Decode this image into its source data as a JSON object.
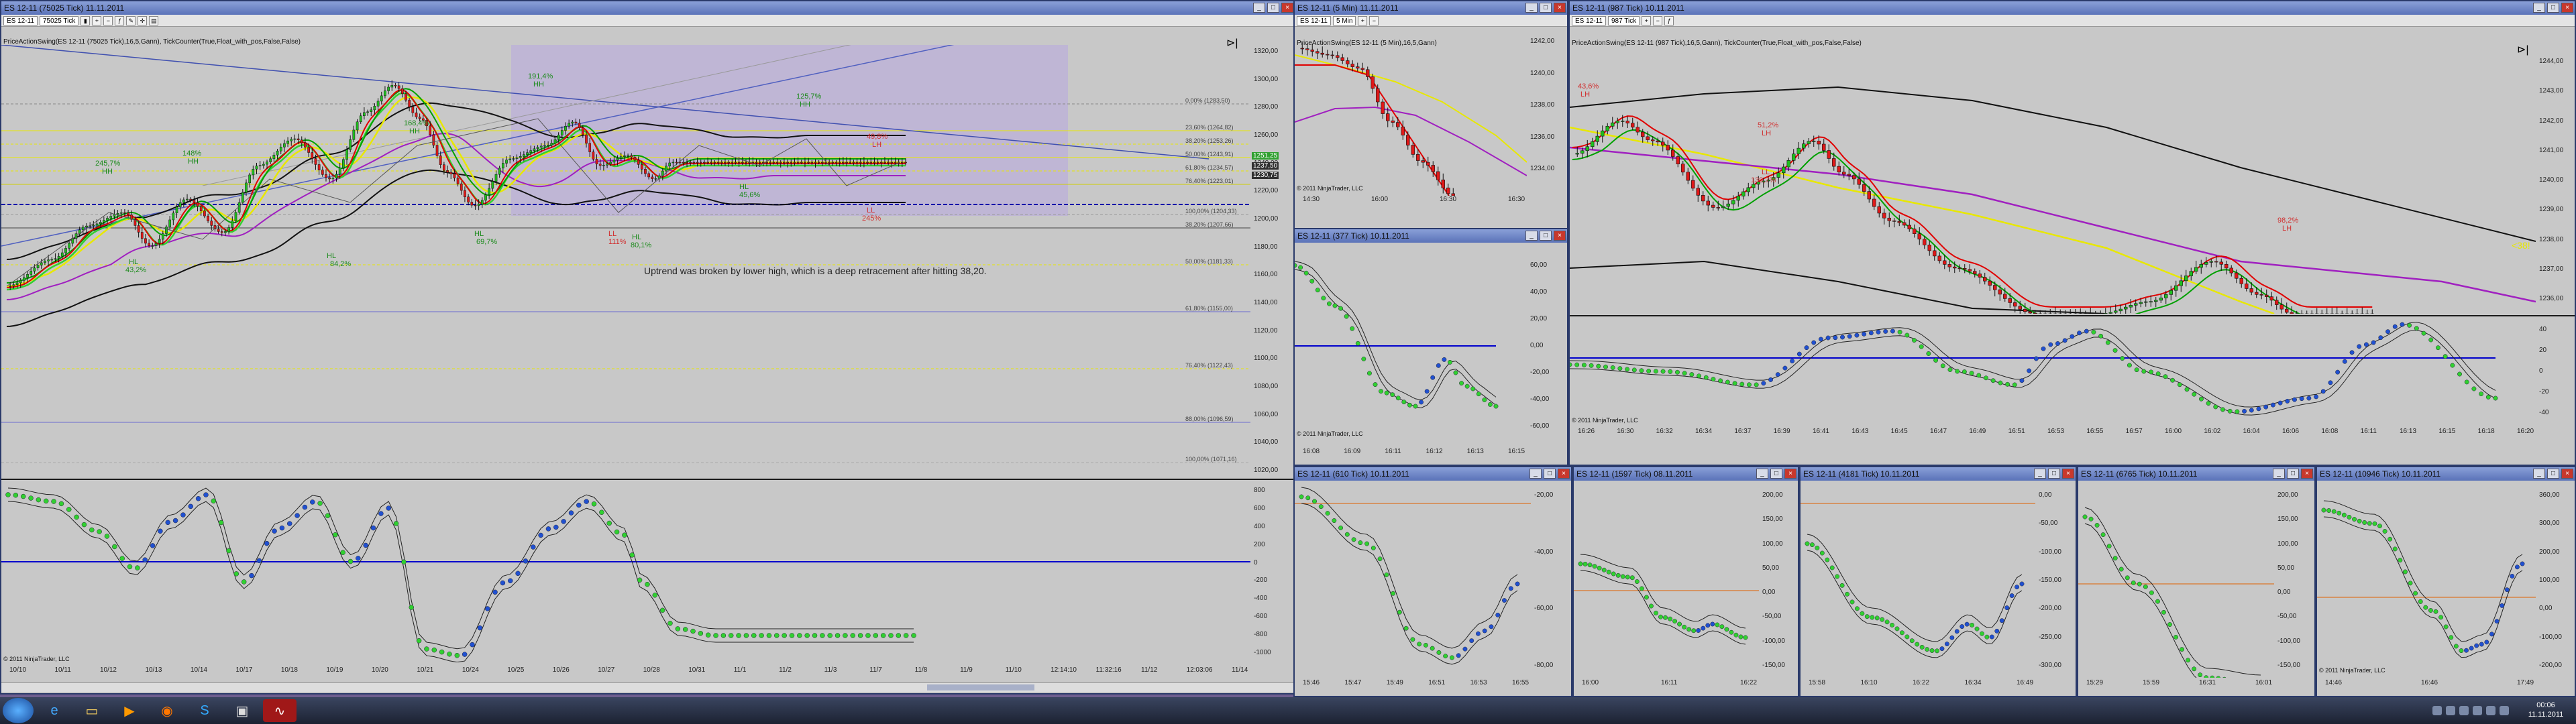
{
  "win_main": {
    "title": "ES 12-11 (75025 Tick)  11.11.2011",
    "instrument": "ES 12-11",
    "period": "75025 Tick",
    "indicator": "PriceActionSwing(ES 12-11 (75025 Tick),16,5,Gann), TickCounter(True,Float_with_pos,False,False)",
    "copyright": "© 2011 NinjaTrader, LLC",
    "annotation": "Uptrend was broken by lower high, which is a deep retracement after hitting 38,20.",
    "price_ticks": [
      "1320,00",
      "1300,00",
      "1280,00",
      "1260,00",
      "1240,00",
      "1220,00",
      "1200,00",
      "1180,00",
      "1160,00",
      "1140,00",
      "1120,00",
      "1100,00",
      "1080,00",
      "1060,00",
      "1040,00",
      "1020,00"
    ],
    "price_tags": [
      "1251,25",
      "1237,50",
      "1230,75"
    ],
    "fib_levels": [
      "0,00% (1283,50)",
      "23,60% (1264,82)",
      "38,20% (1253,26)",
      "50,00% (1243,91)",
      "61,80% (1234,57)",
      "76,40% (1223,01)",
      "100,00% (1204,33)",
      "38,20% (1207,66)",
      "50,00% (1181,33)",
      "61,80% (1155,00)",
      "76,40% (1122,43)",
      "88,00% (1096,59)",
      "100,00% (1071,16)"
    ],
    "osc_ticks": [
      "800",
      "600",
      "400",
      "200",
      "0",
      "-200",
      "-400",
      "-600",
      "-800",
      "-1000"
    ],
    "x_ticks": [
      "10/10",
      "10/11",
      "10/12",
      "10/13",
      "10/14",
      "10/17",
      "10/18",
      "10/19",
      "10/20",
      "10/21",
      "10/24",
      "10/25",
      "10/26",
      "10/27",
      "10/28",
      "10/31",
      "11/1",
      "11/2",
      "11/3",
      "11/7",
      "11/8",
      "11/9",
      "11/10",
      "12:14:10",
      "11:32:16",
      "11/12",
      "12:03:06",
      "11/14"
    ],
    "swing_labels": [
      {
        "t": "245,7%",
        "c": "#1a8a1a"
      },
      {
        "t": "HH",
        "c": "#1a8a1a"
      },
      {
        "t": "148%",
        "c": "#1a8a1a"
      },
      {
        "t": "HH",
        "c": "#1a8a1a"
      },
      {
        "t": "168,4%",
        "c": "#1a8a1a"
      },
      {
        "t": "HH",
        "c": "#1a8a1a"
      },
      {
        "t": "191,4%",
        "c": "#1a8a1a"
      },
      {
        "t": "HH",
        "c": "#1a8a1a"
      },
      {
        "t": "HL",
        "c": "#1a8a1a"
      },
      {
        "t": "43,2%",
        "c": "#1a8a1a"
      },
      {
        "t": "HL",
        "c": "#1a8a1a"
      },
      {
        "t": "84,2%",
        "c": "#1a8a1a"
      },
      {
        "t": "HL",
        "c": "#1a8a1a"
      },
      {
        "t": "69,7%",
        "c": "#1a8a1a"
      },
      {
        "t": "LL",
        "c": "#d03030"
      },
      {
        "t": "111%",
        "c": "#d03030"
      },
      {
        "t": "HL",
        "c": "#1a8a1a"
      },
      {
        "t": "80,1%",
        "c": "#1a8a1a"
      },
      {
        "t": "HL",
        "c": "#1a8a1a"
      },
      {
        "t": "45,6%",
        "c": "#1a8a1a"
      },
      {
        "t": "49,8%",
        "c": "#d03030"
      },
      {
        "t": "LH",
        "c": "#d03030"
      },
      {
        "t": "LL",
        "c": "#d03030"
      },
      {
        "t": "245%",
        "c": "#d03030"
      },
      {
        "t": "125,7%",
        "c": "#1a8a1a"
      },
      {
        "t": "HH",
        "c": "#1a8a1a"
      }
    ]
  },
  "win_w1": {
    "title": "ES 12-11 (5 Min)  11.11.2011",
    "instrument": "ES 12-11",
    "period": "5 Min",
    "indicator": "PriceActionSwing(ES 12-11 (5 Min),16,5,Gann)",
    "price_ticks": [
      "1242,00",
      "1240,00",
      "1238,00",
      "1236,00",
      "1234,00"
    ],
    "x_ticks": [
      "14:30",
      "16:00",
      "16:30",
      "16:30"
    ],
    "copyright": "© 2011 NinjaTrader, LLC"
  },
  "win_w2": {
    "title": "ES 12-11 (377 Tick)  10.11.2011",
    "osc_ticks": [
      "60,00",
      "40,00",
      "20,00",
      "0,00",
      "-20,00",
      "-40,00",
      "-60,00"
    ],
    "x_ticks": [
      "16:08",
      "16:09",
      "16:11",
      "16:12",
      "16:13",
      "16:15"
    ],
    "copyright": "© 2011 NinjaTrader, LLC"
  },
  "win_big": {
    "title": "ES 12-11 (987 Tick)  10.11.2011",
    "instrument": "ES 12-11",
    "period": "987 Tick",
    "indicator": "PriceActionSwing(ES 12-11 (987 Tick),16,5,Gann), TickCounter(True,Float_with_pos,False,False)",
    "price_ticks": [
      "1244,00",
      "1243,00",
      "1242,00",
      "1241,00",
      "1240,00",
      "1239,00",
      "1238,00",
      "1237,00",
      "1236,00"
    ],
    "price_tag": "<38!",
    "swing_labels": [
      {
        "t": "43,6%",
        "c": "#d03030"
      },
      {
        "t": "LH",
        "c": "#d03030"
      },
      {
        "t": "51,2%",
        "c": "#d03030"
      },
      {
        "t": "LH",
        "c": "#d03030"
      },
      {
        "t": "LL",
        "c": "#d03030"
      },
      {
        "t": "139,7%",
        "c": "#d03030"
      },
      {
        "t": "98,2%",
        "c": "#d03030"
      },
      {
        "t": "LH",
        "c": "#d03030"
      }
    ],
    "osc_ticks": [
      "40",
      "20",
      "0",
      "-20",
      "-40"
    ],
    "x_ticks": [
      "16:26",
      "16:30",
      "16:32",
      "16:34",
      "16:37",
      "16:39",
      "16:41",
      "16:43",
      "16:45",
      "16:47",
      "16:49",
      "16:51",
      "16:53",
      "16:55",
      "16:57",
      "16:00",
      "16:02",
      "16:04",
      "16:06",
      "16:08",
      "16:11",
      "16:13",
      "16:15",
      "16:18",
      "16:20"
    ],
    "copyright": "© 2011 NinjaTrader, LLC"
  },
  "win_s1": {
    "title": "ES 12-11 (610 Tick)  10.11.2011",
    "osc_ticks": [
      "-20,00",
      "-40,00",
      "-60,00",
      "-80,00"
    ],
    "y_top": "0,00",
    "x_ticks": [
      "15:46",
      "15:47",
      "15:49",
      "16:51",
      "16:53",
      "16:55"
    ],
    "copyright": "© 2011 NinjaTrader, LLC"
  },
  "win_s2": {
    "title": "ES 12-11 (1597 Tick)  08.11.2011",
    "osc_ticks": [
      "200,00",
      "150,00",
      "100,00",
      "50,00",
      "0,00",
      "-50,00",
      "-100,00",
      "-150,00"
    ],
    "x_ticks": [
      "16:00",
      "16:11",
      "16:22"
    ],
    "copyright": "© 2011 NinjaTrader, LLC"
  },
  "win_s3": {
    "title": "ES 12-11 (4181 Tick)  10.11.2011",
    "osc_ticks": [
      "0,00",
      "-50,00",
      "-100,00",
      "-150,00",
      "-200,00",
      "-250,00",
      "-300,00"
    ],
    "x_ticks": [
      "15:58",
      "16:10",
      "16:22",
      "16:34",
      "16:49"
    ],
    "copyright": "© 2011 NinjaTrader, LLC"
  },
  "win_s4": {
    "title": "ES 12-11 (6765 Tick)  10.11.2011",
    "osc_ticks": [
      "200,00",
      "150,00",
      "100,00",
      "50,00",
      "0,00",
      "-50,00",
      "-100,00",
      "-150,00"
    ],
    "x_ticks": [
      "15:29",
      "15:59",
      "16:31",
      "16:01"
    ],
    "copyright": "© 2011 NinjaTrader, LLC"
  },
  "win_s5": {
    "title": "ES 12-11 (10946 Tick)  10.11.2011",
    "osc_ticks": [
      "360,00",
      "300,00",
      "200,00",
      "100,00",
      "0,00",
      "-100,00",
      "-200,00"
    ],
    "x_ticks": [
      "14:46",
      "16:46",
      "17:49"
    ],
    "copyright": "© 2011 NinjaTrader, LLC"
  },
  "taskbar": {
    "time": "00:06",
    "date": "11.11.2011"
  },
  "colors": {
    "bull": "#1fbf1f",
    "bear": "#e01818",
    "ema_green": "#00a000",
    "ema_red": "#e00000",
    "yellow": "#e8e800",
    "purple": "#a020c0",
    "zero": "#0000cc",
    "fib_box": "#b8a8e0"
  }
}
